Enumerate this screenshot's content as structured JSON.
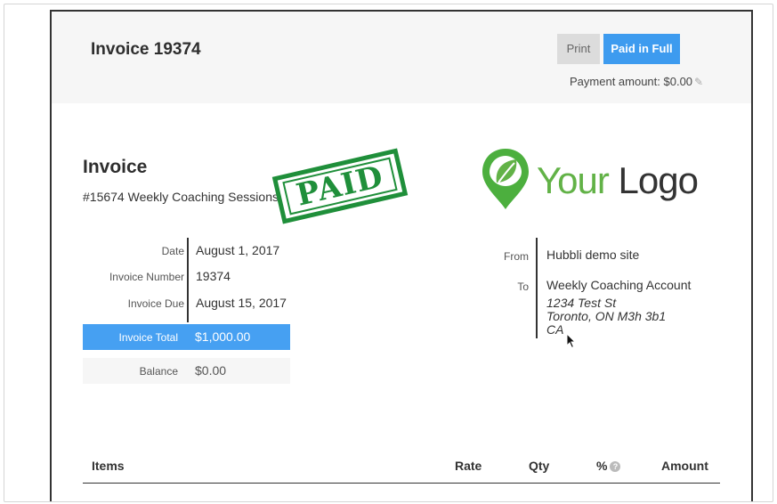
{
  "header": {
    "title": "Invoice 19374",
    "print_label": "Print",
    "paid_label": "Paid in Full",
    "payment_amount": "Payment amount: $0.00",
    "pencil_icon": "pencil-icon"
  },
  "invoice": {
    "heading": "Invoice",
    "subtitle": "#15674 Weekly Coaching Sessions",
    "stamp": "PAID"
  },
  "logo": {
    "word1": "Your",
    "word2": "Logo",
    "icon": "leaf-pin-icon",
    "color_primary": "#62b247",
    "color_dark": "#2e7d32"
  },
  "meta": [
    {
      "label": "Date",
      "value": "August 1, 2017"
    },
    {
      "label": "Invoice Number",
      "value": "19374"
    },
    {
      "label": "Invoice Due",
      "value": "August 15, 2017"
    }
  ],
  "total": {
    "label": "Invoice Total",
    "value": "$1,000.00"
  },
  "balance": {
    "label": "Balance",
    "value": "$0.00"
  },
  "address": {
    "from_label": "From",
    "from_value": "Hubbli demo site",
    "to_label": "To",
    "to_name": "Weekly Coaching Account",
    "to_line1": "1234 Test St",
    "to_line2": "Toronto, ON M3h 3b1",
    "to_line3": "CA"
  },
  "items_table": {
    "columns": [
      "Items",
      "Rate",
      "Qty",
      "%",
      "Amount"
    ]
  },
  "colors": {
    "accent_blue": "#3d9bef",
    "stamp_green": "#1f8f3a"
  }
}
